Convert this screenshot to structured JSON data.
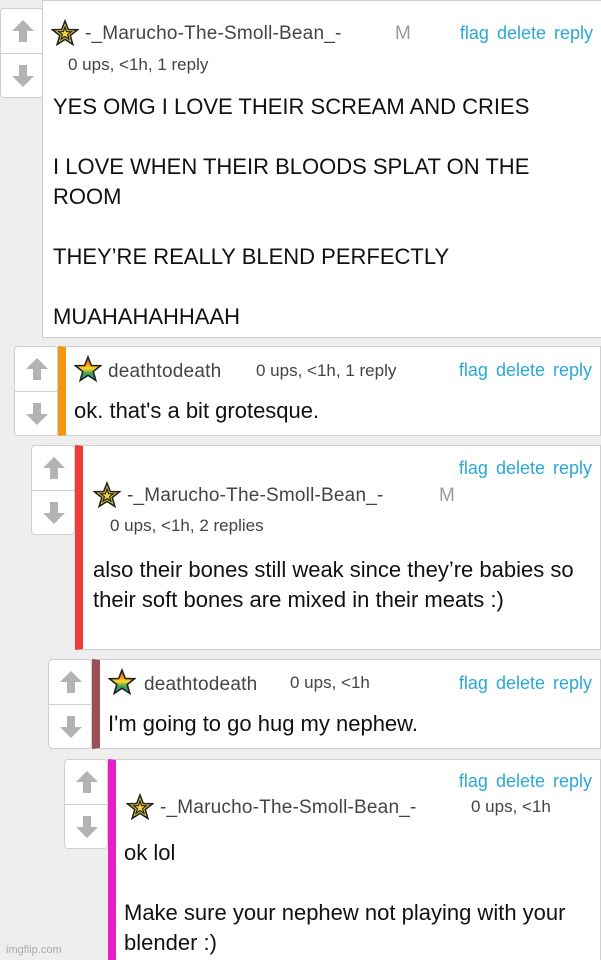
{
  "actions": {
    "flag": "flag",
    "delete": "delete",
    "reply": "reply"
  },
  "accent_colors": {
    "orange": "#f59613",
    "red": "#ee3b3b",
    "brown": "#9b4e56",
    "magenta": "#e61fcb",
    "link": "#2aa9d6"
  },
  "icons": {
    "upvote": "arrow-up-icon",
    "downvote": "arrow-down-icon",
    "avatar_star": "star-icon",
    "avatar_rainbow": "rainbow-star-icon"
  },
  "comments": [
    {
      "username": "-_Marucho-The-Smoll-Bean_-",
      "mod_badge": "M",
      "meta": "0 ups, <1h, 1 reply",
      "text": "YES OMG I LOVE THEIR SCREAM AND CRIES\n\nI LOVE WHEN THEIR BLOODS SPLAT ON THE ROOM\n\nTHEY’RE REALLY BLEND PERFECTLY\n\nMUAHAHAHHAAH"
    },
    {
      "username": "deathtodeath",
      "meta": "0 ups, <1h, 1 reply",
      "text": "ok. that's a bit grotesque."
    },
    {
      "username": "-_Marucho-The-Smoll-Bean_-",
      "mod_badge": "M",
      "meta": "0 ups, <1h, 2 replies",
      "text": "also their bones still weak since they’re babies so their soft bones are mixed in their meats :)"
    },
    {
      "username": "deathtodeath",
      "meta": "0 ups, <1h",
      "text": "I'm going to go hug my nephew."
    },
    {
      "username": "-_Marucho-The-Smoll-Bean_-",
      "meta": "0 ups, <1h",
      "text": "ok lol\n\nMake sure your nephew not playing with your blender :)"
    }
  ],
  "watermark": "imgflip.com"
}
